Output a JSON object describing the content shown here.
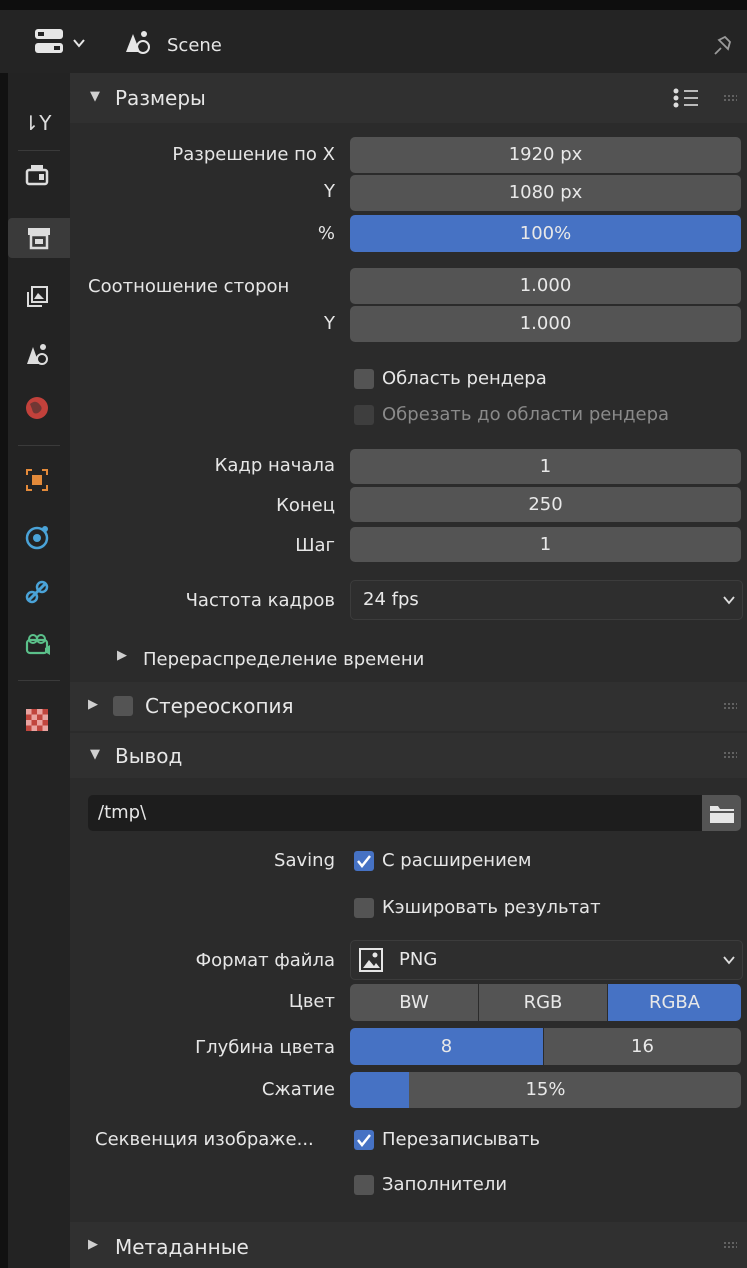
{
  "header": {
    "title": "Scene"
  },
  "sidebar": {
    "icons": [
      "tool-icon",
      "render-icon",
      "output-icon",
      "view-layer-icon",
      "scene-icon",
      "world-icon",
      "object-icon",
      "physics-icon",
      "constraints-icon",
      "object-data-icon",
      "texture-icon"
    ],
    "active": "output-icon"
  },
  "dimensions": {
    "title": "Размеры",
    "res_x_label": "Разрешение по X",
    "res_x": "1920 px",
    "res_y_label": "Y",
    "res_y": "1080 px",
    "pct_label": "%",
    "pct": "100%",
    "aspect_label": "Соотношение сторон",
    "aspect_x": "1.000",
    "aspect_y_label": "Y",
    "aspect_y": "1.000",
    "render_region": "Область рендера",
    "crop_region": "Обрезать до области рендера",
    "frame_start_label": "Кадр начала",
    "frame_start": "1",
    "frame_end_label": "Конец",
    "frame_end": "250",
    "frame_step_label": "Шаг",
    "frame_step": "1",
    "fps_label": "Частота кадров",
    "fps": "24 fps",
    "time_remap": "Перераспределение времени"
  },
  "stereoscopy": {
    "title": "Стереоскопия"
  },
  "output": {
    "title": "Вывод",
    "path": "/tmp\\",
    "saving_label": "Saving",
    "file_ext": "С расширением",
    "cache_result": "Кэшировать результат",
    "format_label": "Формат файла",
    "format": "PNG",
    "color_label": "Цвет",
    "color_options": [
      "BW",
      "RGB",
      "RGBA"
    ],
    "color_selected": "RGBA",
    "depth_label": "Глубина цвета",
    "depth_options": [
      "8",
      "16"
    ],
    "depth_selected": "8",
    "compress_label": "Сжатие",
    "compress": "15%",
    "compress_value": 0.15,
    "sequence_label": "Секвенция изображе...",
    "overwrite": "Перезаписывать",
    "placeholders": "Заполнители"
  },
  "metadata": {
    "title": "Метаданные"
  },
  "colors": {
    "accent": "#4672c4",
    "panel": "#303030",
    "field": "#545454",
    "background": "#2b2b2b"
  }
}
